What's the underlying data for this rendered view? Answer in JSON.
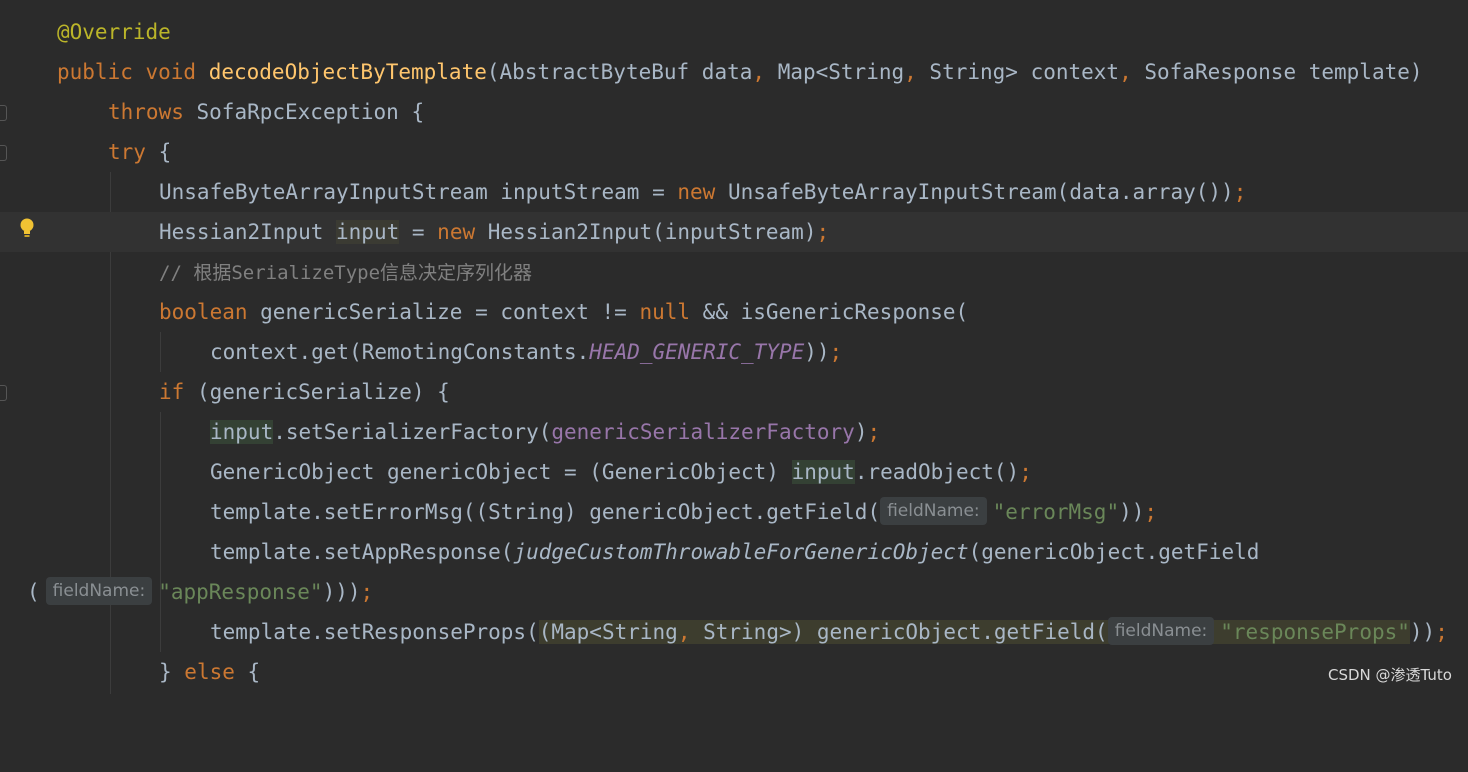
{
  "editor": {
    "lines": {
      "l1": {
        "annotation": "@Override"
      },
      "l2": {
        "modifiers": "public void ",
        "method": "decodeObjectByTemplate",
        "p1": "(AbstractByteBuf data",
        "c1": ", ",
        "p2": "Map<String",
        "c2": ", ",
        "p3": "String> context",
        "c3": ", ",
        "p4": "SofaResponse template)"
      },
      "l3": {
        "kw": "throws ",
        "rest": "SofaRpcException {"
      },
      "l4": {
        "kw": "try ",
        "rest": "{"
      },
      "l5": {
        "a": "UnsafeByteArrayInputStream inputStream = ",
        "kw": "new ",
        "b": "UnsafeByteArrayInputStream(data.array())",
        "semi": ";"
      },
      "l6": {
        "a": "Hessian2Input ",
        "var": "input",
        "b": " = ",
        "kw": "new ",
        "c": "Hessian2Input(inputStream)",
        "semi": ";"
      },
      "l7": {
        "comment": "// 根据SerializeType信息决定序列化器"
      },
      "l8": {
        "kw": "boolean ",
        "a": "genericSerialize = context != ",
        "kw2": "null ",
        "b": "&& isGenericResponse("
      },
      "l9": {
        "a": "context.get(RemotingConstants.",
        "const": "HEAD_GENERIC_TYPE",
        "b": "))",
        "semi": ";"
      },
      "l10": {
        "kw": "if ",
        "rest": "(genericSerialize) {"
      },
      "l11": {
        "var": "input",
        "a": ".setSerializerFactory(",
        "field": "genericSerializerFactory",
        "b": ")",
        "semi": ";"
      },
      "l12": {
        "a": "GenericObject genericObject = (GenericObject) ",
        "var": "input",
        "b": ".readObject()",
        "semi": ";"
      },
      "l13": {
        "a": "template.setErrorMsg((String) genericObject.getField(",
        "hint": "fieldName:",
        "str": "\"errorMsg\"",
        "b": "))",
        "semi": ";"
      },
      "l14": {
        "a": "template.setAppResponse(",
        "ital": "judgeCustomThrowableForGenericObject",
        "b": "(genericObject.getField"
      },
      "l15": {
        "a": "(",
        "hint": "fieldName:",
        "str": "\"appResponse\"",
        "b": ")))",
        "semi": ";"
      },
      "l16": {
        "a": "template.setResponseProps(",
        "box1": "(Map<String",
        "comma": ", ",
        "box2": "String>) genericObject.getField(",
        "hint": "fieldName:",
        "str": "\"responseProps\"",
        "b": "))",
        "semi": ";"
      },
      "l17": {
        "a": "} ",
        "kw": "else ",
        "b": "{"
      }
    }
  },
  "watermark": "CSDN @渗透Tuto",
  "icons": {
    "intention": "lightbulb-icon",
    "fold": "fold-marker-icon"
  },
  "colors": {
    "background": "#2b2b2b",
    "keyword": "#cc7832",
    "method": "#ffc66d",
    "string": "#6a8759",
    "field": "#9876aa",
    "text": "#a9b7c6",
    "comment": "#808080"
  }
}
